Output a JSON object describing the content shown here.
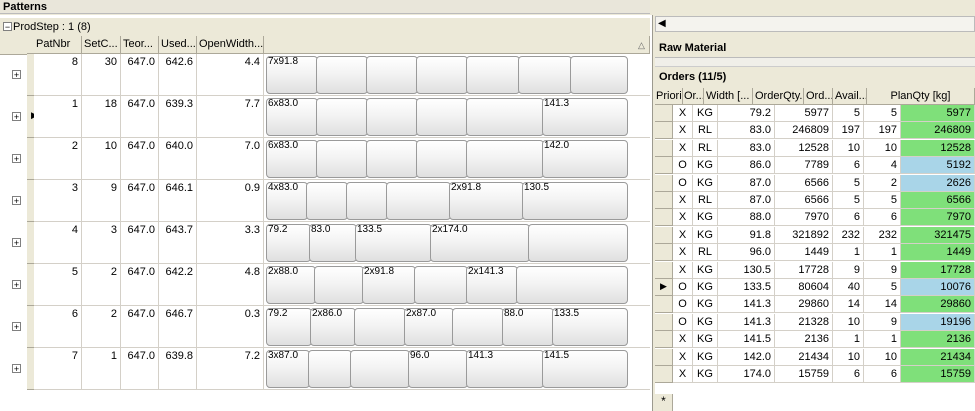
{
  "patterns": {
    "title": "Patterns",
    "group_label": "ProdStep : 1 (8)",
    "group_toggle": "−",
    "headers": [
      "PatNbr",
      "SetC...",
      "Teor...",
      "Used...",
      "OpenWidth..."
    ],
    "rows": [
      {
        "patnbr": "8",
        "setc": "30",
        "teor": "647.0",
        "used": "642.6",
        "open": "4.4",
        "labels": [
          "7x91.8"
        ],
        "current": false
      },
      {
        "patnbr": "1",
        "setc": "18",
        "teor": "647.0",
        "used": "639.3",
        "open": "7.7",
        "labels": [
          "6x83.0",
          "141.3"
        ],
        "current": true
      },
      {
        "patnbr": "2",
        "setc": "10",
        "teor": "647.0",
        "used": "640.0",
        "open": "7.0",
        "labels": [
          "6x83.0",
          "142.0"
        ],
        "current": false
      },
      {
        "patnbr": "3",
        "setc": "9",
        "teor": "647.0",
        "used": "646.1",
        "open": "0.9",
        "labels": [
          "4x83.0",
          "2x91.8",
          "130.5"
        ],
        "current": false
      },
      {
        "patnbr": "4",
        "setc": "3",
        "teor": "647.0",
        "used": "643.7",
        "open": "3.3",
        "labels": [
          "79.2",
          "83.0",
          "133.5",
          "2x174.0"
        ],
        "current": false
      },
      {
        "patnbr": "5",
        "setc": "2",
        "teor": "647.0",
        "used": "642.2",
        "open": "4.8",
        "labels": [
          "2x88.0",
          "2x91.8",
          "2x141.3"
        ],
        "current": false
      },
      {
        "patnbr": "6",
        "setc": "2",
        "teor": "647.0",
        "used": "646.7",
        "open": "0.3",
        "labels": [
          "79.2",
          "2x86.0",
          "2x87.0",
          "88.0",
          "133.5"
        ],
        "current": false
      },
      {
        "patnbr": "7",
        "setc": "1",
        "teor": "647.0",
        "used": "639.8",
        "open": "7.2",
        "labels": [
          "3x87.0",
          "96.0",
          "141.3",
          "141.5"
        ],
        "current": false
      }
    ],
    "expand_symbol": "+",
    "current_row_marker": "▶"
  },
  "raw_material": {
    "title": "Raw Material"
  },
  "orders": {
    "title": "Orders (11/5)",
    "headers": [
      "Priori...",
      "Or...",
      "Width [...",
      "OrderQty...",
      "Ord...",
      "Avail...",
      "PlanQty [kg]"
    ],
    "new_row_marker": "*",
    "current_row_marker": "▶",
    "rows": [
      {
        "prio": "X",
        "or": "KG",
        "width": "79.2",
        "qty": "5977",
        "ord": "5",
        "avail": "5",
        "plan": "5977",
        "color": "green",
        "current": false
      },
      {
        "prio": "X",
        "or": "RL",
        "width": "83.0",
        "qty": "246809",
        "ord": "197",
        "avail": "197",
        "plan": "246809",
        "color": "green",
        "current": false
      },
      {
        "prio": "X",
        "or": "RL",
        "width": "83.0",
        "qty": "12528",
        "ord": "10",
        "avail": "10",
        "plan": "12528",
        "color": "green",
        "current": false
      },
      {
        "prio": "O",
        "or": "KG",
        "width": "86.0",
        "qty": "7789",
        "ord": "6",
        "avail": "4",
        "plan": "5192",
        "color": "blue",
        "current": false
      },
      {
        "prio": "O",
        "or": "KG",
        "width": "87.0",
        "qty": "6566",
        "ord": "5",
        "avail": "2",
        "plan": "2626",
        "color": "blue",
        "current": false
      },
      {
        "prio": "X",
        "or": "RL",
        "width": "87.0",
        "qty": "6566",
        "ord": "5",
        "avail": "5",
        "plan": "6566",
        "color": "green",
        "current": false
      },
      {
        "prio": "X",
        "or": "KG",
        "width": "88.0",
        "qty": "7970",
        "ord": "6",
        "avail": "6",
        "plan": "7970",
        "color": "green",
        "current": false
      },
      {
        "prio": "X",
        "or": "KG",
        "width": "91.8",
        "qty": "321892",
        "ord": "232",
        "avail": "232",
        "plan": "321475",
        "color": "green",
        "current": false
      },
      {
        "prio": "X",
        "or": "RL",
        "width": "96.0",
        "qty": "1449",
        "ord": "1",
        "avail": "1",
        "plan": "1449",
        "color": "green",
        "current": false
      },
      {
        "prio": "X",
        "or": "KG",
        "width": "130.5",
        "qty": "17728",
        "ord": "9",
        "avail": "9",
        "plan": "17728",
        "color": "green",
        "current": false
      },
      {
        "prio": "O",
        "or": "KG",
        "width": "133.5",
        "qty": "80604",
        "ord": "40",
        "avail": "5",
        "plan": "10076",
        "color": "blue",
        "current": true
      },
      {
        "prio": "O",
        "or": "KG",
        "width": "141.3",
        "qty": "29860",
        "ord": "14",
        "avail": "14",
        "plan": "29860",
        "color": "green",
        "current": false
      },
      {
        "prio": "O",
        "or": "KG",
        "width": "141.3",
        "qty": "21328",
        "ord": "10",
        "avail": "9",
        "plan": "19196",
        "color": "blue",
        "current": false
      },
      {
        "prio": "X",
        "or": "KG",
        "width": "141.5",
        "qty": "2136",
        "ord": "1",
        "avail": "1",
        "plan": "2136",
        "color": "green",
        "current": false
      },
      {
        "prio": "X",
        "or": "KG",
        "width": "142.0",
        "qty": "21434",
        "ord": "10",
        "avail": "10",
        "plan": "21434",
        "color": "green",
        "current": false
      },
      {
        "prio": "X",
        "or": "KG",
        "width": "174.0",
        "qty": "15759",
        "ord": "6",
        "avail": "6",
        "plan": "15759",
        "color": "green",
        "current": false
      }
    ]
  },
  "colors": {
    "planned_full": "#7fe07a",
    "planned_partial": "#a9d5e8",
    "chrome": "#ece9d8"
  }
}
